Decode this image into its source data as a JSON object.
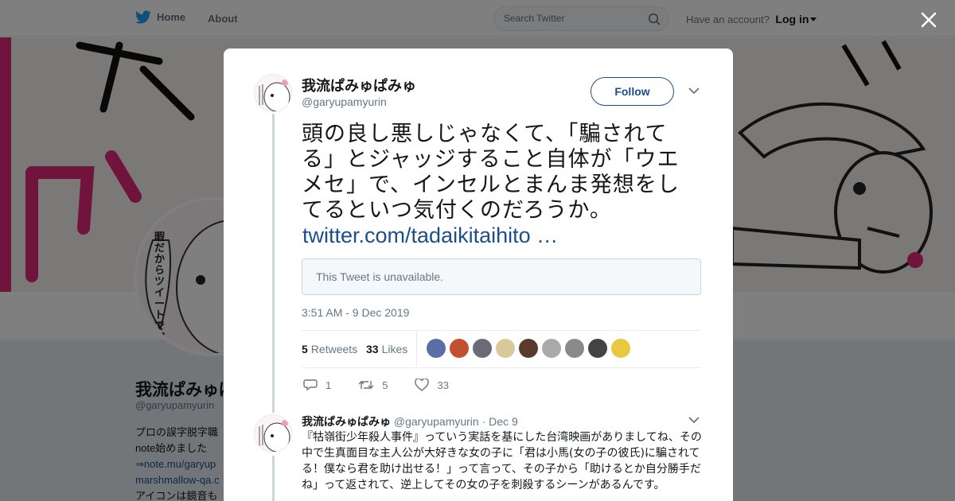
{
  "topbar": {
    "home_label": "Home",
    "about_label": "About",
    "search_placeholder": "Search Twitter",
    "account_prompt": "Have an account?",
    "login_label": "Log in"
  },
  "profile": {
    "name": "我流ぱみゅぱみゅ",
    "handle": "@garyupamyurin",
    "bio_lines": [
      "プロの誤字脱字職",
      "note始めました",
      "⇒note.mu/garyup",
      "marshmallow-qa.c",
      "アイコンは鏡音も"
    ],
    "avatar_text": "暇だからツイートでTLに不穏な流すか"
  },
  "tweet": {
    "author_name": "我流ぱみゅぱみゅ",
    "author_handle": "@garyupamyurin",
    "follow_label": "Follow",
    "text": "頭の良し悪しじゃなくて、「騙されてる」とジャッジすること自体が「ウエメセ」で、インセルとまんま発想をしてるといつ気付くのだろうか。",
    "link": "twitter.com/tadaikitaihito …",
    "quote_unavailable": "This Tweet is unavailable.",
    "timestamp": "3:51 AM - 9 Dec 2019",
    "retweets_count": "5",
    "retweets_label": "Retweets",
    "likes_count": "33",
    "likes_label": "Likes",
    "reply_count": "1",
    "retweet_action_count": "5",
    "like_action_count": "33",
    "liker_colors": [
      "#5a6fa8",
      "#c0502e",
      "#6b6b78",
      "#d8c89a",
      "#5b3a2e",
      "#aaaaaa",
      "#8a8a8a",
      "#444444",
      "#e8c840"
    ]
  },
  "reply": {
    "author_name": "我流ぱみゅぱみゅ",
    "author_handle": "@garyupamyurin",
    "date": "Dec 9",
    "text": "『牯嶺街少年殺人事件』っていう実話を基にした台湾映画がありましてね、その中で生真面目な主人公が大好きな女の子に「君は小馬(女の子の彼氏)に騙されてる！僕なら君を助け出せる！」って言って、その子から「助けるとか自分勝手だね」って返されて、逆上してその女の子を刺殺するシーンがあるんです。"
  },
  "colors": {
    "accent": "#1b4f8c",
    "twitter_blue": "#1da1f2",
    "banner_magenta": "#e0267a"
  }
}
